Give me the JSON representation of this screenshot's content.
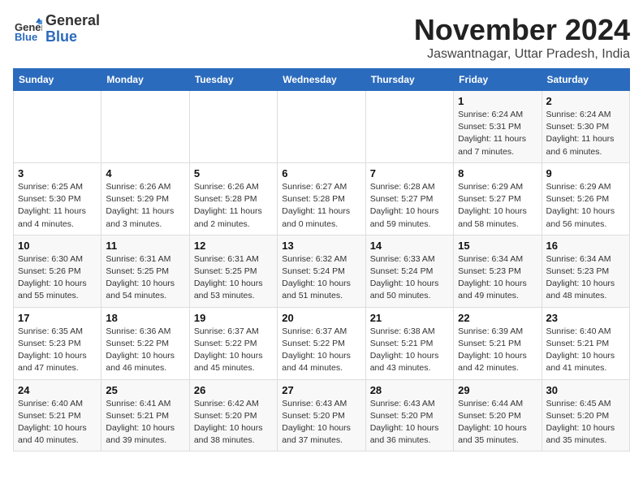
{
  "header": {
    "logo_general": "General",
    "logo_blue": "Blue",
    "title": "November 2024",
    "location": "Jaswantnagar, Uttar Pradesh, India"
  },
  "weekdays": [
    "Sunday",
    "Monday",
    "Tuesday",
    "Wednesday",
    "Thursday",
    "Friday",
    "Saturday"
  ],
  "weeks": [
    [
      {
        "day": "",
        "info": ""
      },
      {
        "day": "",
        "info": ""
      },
      {
        "day": "",
        "info": ""
      },
      {
        "day": "",
        "info": ""
      },
      {
        "day": "",
        "info": ""
      },
      {
        "day": "1",
        "info": "Sunrise: 6:24 AM\nSunset: 5:31 PM\nDaylight: 11 hours\nand 7 minutes."
      },
      {
        "day": "2",
        "info": "Sunrise: 6:24 AM\nSunset: 5:30 PM\nDaylight: 11 hours\nand 6 minutes."
      }
    ],
    [
      {
        "day": "3",
        "info": "Sunrise: 6:25 AM\nSunset: 5:30 PM\nDaylight: 11 hours\nand 4 minutes."
      },
      {
        "day": "4",
        "info": "Sunrise: 6:26 AM\nSunset: 5:29 PM\nDaylight: 11 hours\nand 3 minutes."
      },
      {
        "day": "5",
        "info": "Sunrise: 6:26 AM\nSunset: 5:28 PM\nDaylight: 11 hours\nand 2 minutes."
      },
      {
        "day": "6",
        "info": "Sunrise: 6:27 AM\nSunset: 5:28 PM\nDaylight: 11 hours\nand 0 minutes."
      },
      {
        "day": "7",
        "info": "Sunrise: 6:28 AM\nSunset: 5:27 PM\nDaylight: 10 hours\nand 59 minutes."
      },
      {
        "day": "8",
        "info": "Sunrise: 6:29 AM\nSunset: 5:27 PM\nDaylight: 10 hours\nand 58 minutes."
      },
      {
        "day": "9",
        "info": "Sunrise: 6:29 AM\nSunset: 5:26 PM\nDaylight: 10 hours\nand 56 minutes."
      }
    ],
    [
      {
        "day": "10",
        "info": "Sunrise: 6:30 AM\nSunset: 5:26 PM\nDaylight: 10 hours\nand 55 minutes."
      },
      {
        "day": "11",
        "info": "Sunrise: 6:31 AM\nSunset: 5:25 PM\nDaylight: 10 hours\nand 54 minutes."
      },
      {
        "day": "12",
        "info": "Sunrise: 6:31 AM\nSunset: 5:25 PM\nDaylight: 10 hours\nand 53 minutes."
      },
      {
        "day": "13",
        "info": "Sunrise: 6:32 AM\nSunset: 5:24 PM\nDaylight: 10 hours\nand 51 minutes."
      },
      {
        "day": "14",
        "info": "Sunrise: 6:33 AM\nSunset: 5:24 PM\nDaylight: 10 hours\nand 50 minutes."
      },
      {
        "day": "15",
        "info": "Sunrise: 6:34 AM\nSunset: 5:23 PM\nDaylight: 10 hours\nand 49 minutes."
      },
      {
        "day": "16",
        "info": "Sunrise: 6:34 AM\nSunset: 5:23 PM\nDaylight: 10 hours\nand 48 minutes."
      }
    ],
    [
      {
        "day": "17",
        "info": "Sunrise: 6:35 AM\nSunset: 5:23 PM\nDaylight: 10 hours\nand 47 minutes."
      },
      {
        "day": "18",
        "info": "Sunrise: 6:36 AM\nSunset: 5:22 PM\nDaylight: 10 hours\nand 46 minutes."
      },
      {
        "day": "19",
        "info": "Sunrise: 6:37 AM\nSunset: 5:22 PM\nDaylight: 10 hours\nand 45 minutes."
      },
      {
        "day": "20",
        "info": "Sunrise: 6:37 AM\nSunset: 5:22 PM\nDaylight: 10 hours\nand 44 minutes."
      },
      {
        "day": "21",
        "info": "Sunrise: 6:38 AM\nSunset: 5:21 PM\nDaylight: 10 hours\nand 43 minutes."
      },
      {
        "day": "22",
        "info": "Sunrise: 6:39 AM\nSunset: 5:21 PM\nDaylight: 10 hours\nand 42 minutes."
      },
      {
        "day": "23",
        "info": "Sunrise: 6:40 AM\nSunset: 5:21 PM\nDaylight: 10 hours\nand 41 minutes."
      }
    ],
    [
      {
        "day": "24",
        "info": "Sunrise: 6:40 AM\nSunset: 5:21 PM\nDaylight: 10 hours\nand 40 minutes."
      },
      {
        "day": "25",
        "info": "Sunrise: 6:41 AM\nSunset: 5:21 PM\nDaylight: 10 hours\nand 39 minutes."
      },
      {
        "day": "26",
        "info": "Sunrise: 6:42 AM\nSunset: 5:20 PM\nDaylight: 10 hours\nand 38 minutes."
      },
      {
        "day": "27",
        "info": "Sunrise: 6:43 AM\nSunset: 5:20 PM\nDaylight: 10 hours\nand 37 minutes."
      },
      {
        "day": "28",
        "info": "Sunrise: 6:43 AM\nSunset: 5:20 PM\nDaylight: 10 hours\nand 36 minutes."
      },
      {
        "day": "29",
        "info": "Sunrise: 6:44 AM\nSunset: 5:20 PM\nDaylight: 10 hours\nand 35 minutes."
      },
      {
        "day": "30",
        "info": "Sunrise: 6:45 AM\nSunset: 5:20 PM\nDaylight: 10 hours\nand 35 minutes."
      }
    ]
  ]
}
